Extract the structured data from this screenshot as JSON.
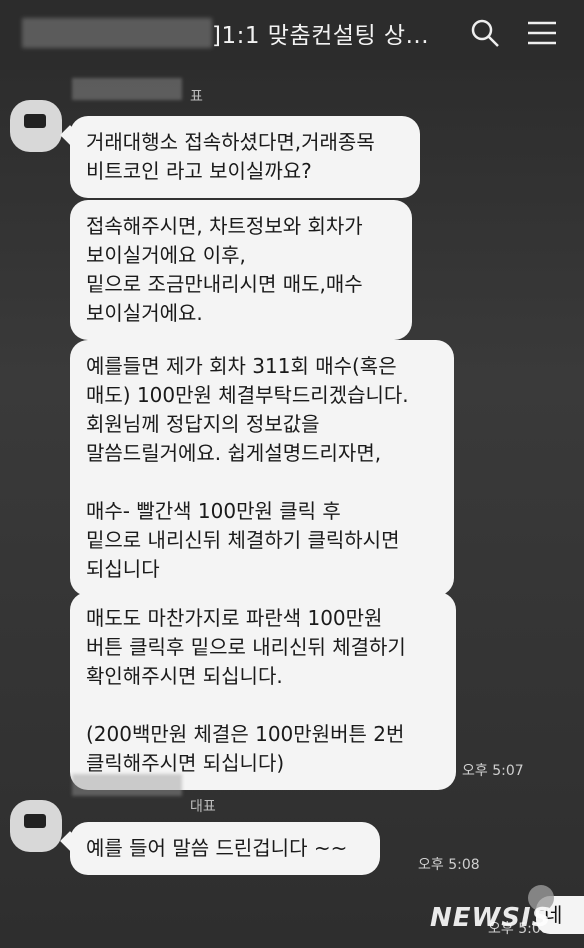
{
  "header": {
    "title": "]1:1 맞춤컨설팅 상...",
    "search_icon": "search-icon",
    "menu_icon": "hamburger-menu-icon"
  },
  "sender1": {
    "suffix": "표"
  },
  "messages": [
    {
      "text": "거래대행소 접속하셨다면,거래종목\n비트코인 라고 보이실까요?"
    },
    {
      "text": "접속해주시면, 차트정보와 회차가\n보이실거에요 이후,\n밑으로 조금만내리시면 매도,매수\n보이실거에요."
    },
    {
      "text": "예를들면 제가 회차 311회 매수(혹은\n매도) 100만원 체결부탁드리겠습니다.\n회원님께 정답지의 정보값을\n말씀드릴거에요. 쉽게설명드리자면,\n\n매수- 빨간색 100만원 클릭 후\n 밑으로 내리신뒤 체결하기 클릭하시면\n되십니다"
    },
    {
      "text": "매도도 마찬가지로 파란색 100만원\n버튼 클릭후 밑으로 내리신뒤 체결하기\n확인해주시면 되십니다.\n\n(200백만원 체결은 100만원버튼 2번\n클릭해주시면 되십니다)"
    }
  ],
  "time1": "오후 5:07",
  "sender2": {
    "suffix": "대표"
  },
  "message5": "예를 들어 말씀 드린겁니다 ~~",
  "time2": "오후 5:08",
  "time3": "오후 5:08",
  "partial_reply": "네",
  "watermark": "NEWSIS"
}
